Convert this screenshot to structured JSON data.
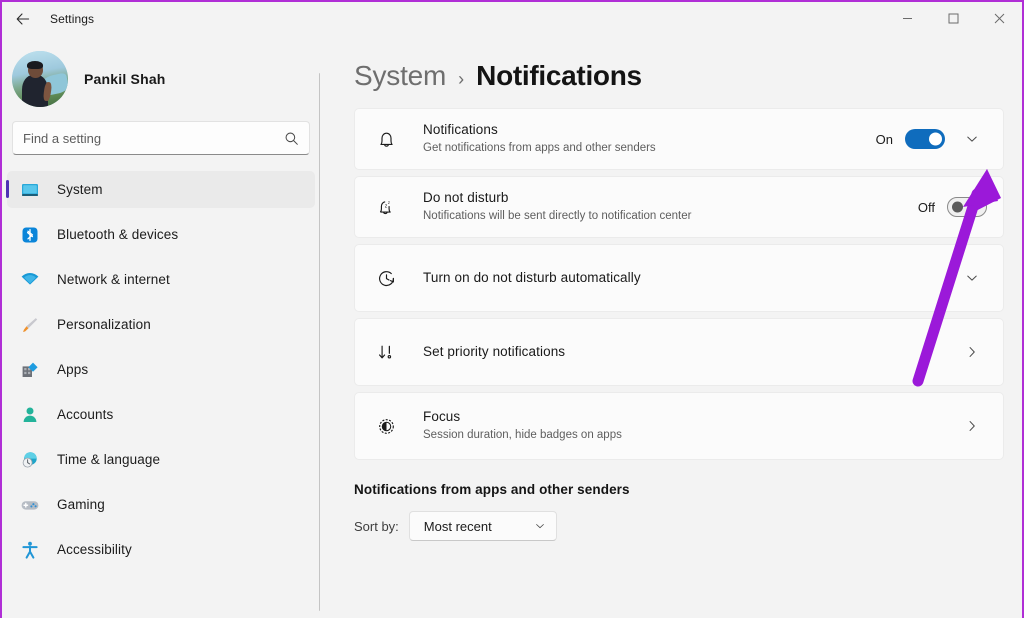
{
  "window": {
    "title": "Settings",
    "back_icon": "back-arrow-icon",
    "minimize_label": "—",
    "maximize_label": "☐",
    "close_label": "✕"
  },
  "sidebar": {
    "profile": {
      "name": "Pankil Shah"
    },
    "search": {
      "placeholder": "Find a setting",
      "value": "",
      "icon": "search-icon"
    },
    "items": [
      {
        "label": "System",
        "icon": "monitor-icon",
        "active": true
      },
      {
        "label": "Bluetooth & devices",
        "icon": "bluetooth-icon",
        "active": false
      },
      {
        "label": "Network & internet",
        "icon": "wifi-icon",
        "active": false
      },
      {
        "label": "Personalization",
        "icon": "paintbrush-icon",
        "active": false
      },
      {
        "label": "Apps",
        "icon": "apps-icon",
        "active": false
      },
      {
        "label": "Accounts",
        "icon": "person-icon",
        "active": false
      },
      {
        "label": "Time & language",
        "icon": "clock-globe-icon",
        "active": false
      },
      {
        "label": "Gaming",
        "icon": "gamepad-icon",
        "active": false
      },
      {
        "label": "Accessibility",
        "icon": "accessibility-icon",
        "active": false
      }
    ]
  },
  "main": {
    "breadcrumb": {
      "parent": "System",
      "separator": "›",
      "current": "Notifications"
    },
    "rows": [
      {
        "title": "Notifications",
        "subtitle": "Get notifications from apps and other senders",
        "icon": "bell-icon",
        "control": "toggle",
        "toggle_state": "On",
        "toggle_label": "On",
        "chevron": "chevron-down-icon"
      },
      {
        "title": "Do not disturb",
        "subtitle": "Notifications will be sent directly to notification center",
        "icon": "bell-sleep-icon",
        "control": "toggle",
        "toggle_state": "Off",
        "toggle_label": "Off",
        "chevron": ""
      },
      {
        "title": "Turn on do not disturb automatically",
        "subtitle": "",
        "icon": "clock-arrow-icon",
        "control": "expander",
        "toggle_state": "",
        "toggle_label": "",
        "chevron": "chevron-down-icon"
      },
      {
        "title": "Set priority notifications",
        "subtitle": "",
        "icon": "priority-icon",
        "control": "navigate",
        "toggle_state": "",
        "toggle_label": "",
        "chevron": "chevron-right-icon"
      },
      {
        "title": "Focus",
        "subtitle": "Session duration, hide badges on apps",
        "icon": "focus-icon",
        "control": "navigate",
        "toggle_state": "",
        "toggle_label": "",
        "chevron": "chevron-right-icon"
      }
    ],
    "section": {
      "title": "Notifications from apps and other senders",
      "sort_label": "Sort by:",
      "sort_value": "Most recent",
      "sort_chevron": "chevron-down-icon"
    }
  },
  "annotation": {
    "type": "arrow",
    "color": "#9b19d9",
    "points_to": "notifications-expand-chevron"
  },
  "colors": {
    "accent_toggle_on": "#0f6cbd",
    "page_background": "#f3f3f3",
    "card_background": "#fbfbfb",
    "nav_active_bar": "#4f32b3",
    "annotation": "#9b19d9",
    "window_border": "#b02ed6"
  }
}
